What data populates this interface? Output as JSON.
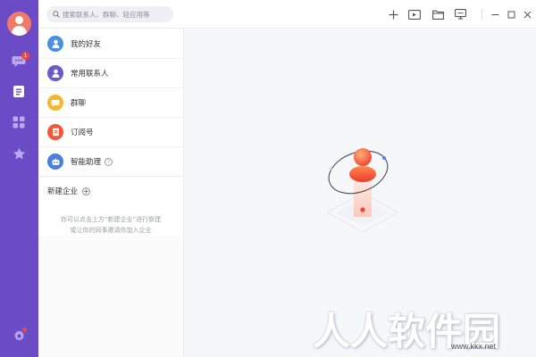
{
  "search": {
    "placeholder": "搜索联系人、群聊、轻应用等"
  },
  "rail": {
    "unread_badge": "1",
    "items": [
      {
        "icon": "chat-icon"
      },
      {
        "icon": "contacts-icon"
      },
      {
        "icon": "apps-grid-icon"
      },
      {
        "icon": "star-icon"
      }
    ],
    "settings_icon": "gear-icon"
  },
  "contacts": {
    "items": [
      {
        "label": "我的好友",
        "icon": "person-icon",
        "color": "#4a90e2"
      },
      {
        "label": "常用联系人",
        "icon": "person-icon",
        "color": "#6a5acd"
      },
      {
        "label": "群聊",
        "icon": "group-chat-icon",
        "color": "#f5b731"
      },
      {
        "label": "订阅号",
        "icon": "subscription-icon",
        "color": "#f0583a"
      },
      {
        "label": "智能助理",
        "icon": "robot-icon",
        "color": "#4a7fe0",
        "help": "?"
      }
    ],
    "new_enterprise": "新建企业",
    "hint_line1": "你可以点击上方“新建企业”进行新建",
    "hint_line2": "或让你的同事邀请你加入企业"
  },
  "watermark": {
    "text": "人人软件园",
    "url": "www.kkx.net"
  },
  "colors": {
    "rail": "#6b4cc6",
    "accent_orange": "#f5663b",
    "badge": "#f0473b"
  }
}
